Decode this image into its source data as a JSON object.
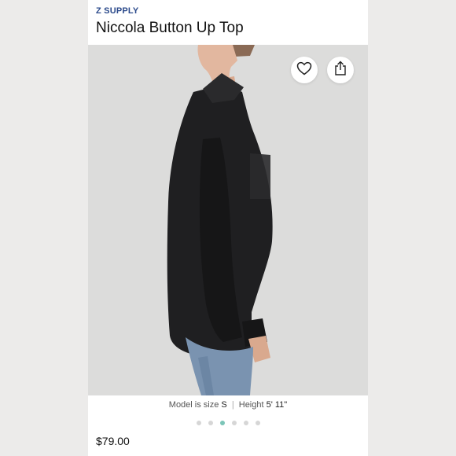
{
  "product": {
    "brand": "Z SUPPLY",
    "title": "Niccola Button Up Top",
    "price": "$79.00"
  },
  "photo": {
    "caption_prefix": "Model is size",
    "size": "S",
    "caption_separator": "|",
    "height_label": "Height",
    "height_value": "5' 11\""
  },
  "actions": {
    "favorite_icon": "heart-icon",
    "share_icon": "share-icon"
  },
  "carousel": {
    "total": 6,
    "active_index": 2,
    "active_color": "#7cc5b8",
    "inactive_color": "#d6d6d6"
  },
  "colors": {
    "brand": "#2b4a8b"
  }
}
